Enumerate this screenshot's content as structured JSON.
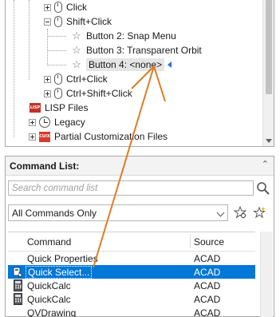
{
  "tree": {
    "items": [
      {
        "label": "Click",
        "icon": "mouse-icon"
      },
      {
        "label": "Shift+Click",
        "icon": "mouse-icon"
      },
      {
        "label": "Button 2: Snap Menu",
        "icon": "star-icon"
      },
      {
        "label": "Button 3: Transparent Orbit",
        "icon": "star-icon"
      },
      {
        "label": "Button 4: <none>",
        "icon": "star-icon"
      },
      {
        "label": "Ctrl+Click",
        "icon": "mouse-icon"
      },
      {
        "label": "Ctrl+Shift+Click",
        "icon": "mouse-icon"
      },
      {
        "label": "LISP Files",
        "icon": "lisp-files-icon",
        "icon_text": "LISP"
      },
      {
        "label": "Legacy",
        "icon": "legacy-icon"
      },
      {
        "label": "Partial Customization Files",
        "icon": "cuix-file-icon",
        "icon_text": "CUIX"
      }
    ]
  },
  "command_list": {
    "title": "Command List:",
    "search_placeholder": "Search command list",
    "filter_value": "All Commands Only",
    "columns": {
      "command": "Command",
      "source": "Source"
    },
    "rows": [
      {
        "command": "Quick Properties",
        "source": "ACAD",
        "icon": ""
      },
      {
        "command": "Quick Select...",
        "source": "ACAD",
        "icon": "quick-select-icon",
        "selected": true
      },
      {
        "command": "QuickCalc",
        "source": "ACAD",
        "icon": "calculator-icon"
      },
      {
        "command": "QuickCalc",
        "source": "ACAD",
        "icon": "calculator-icon"
      },
      {
        "command": "QVDrawing",
        "source": "ACAD",
        "icon": ""
      }
    ]
  },
  "colors": {
    "selection": "#0078d7",
    "annotation_arrow": "#e07b24",
    "marker": "#2e6fd1"
  }
}
